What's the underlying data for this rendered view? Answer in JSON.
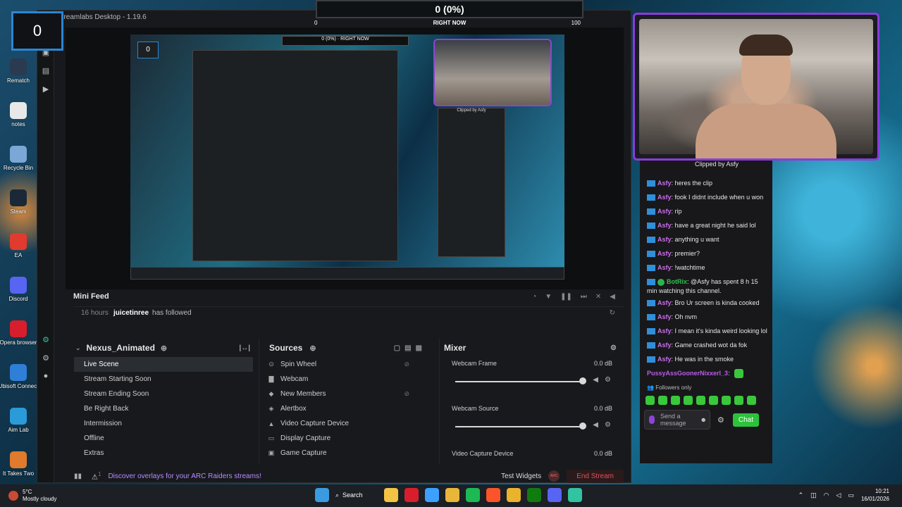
{
  "desktop": {
    "icons": [
      {
        "label": "Rematch",
        "color": "#2a3a50"
      },
      {
        "label": "notes",
        "color": "#e8e8e8"
      },
      {
        "label": "Recycle Bin",
        "color": "#7aa7d6"
      },
      {
        "label": "Steam",
        "color": "#1b2838"
      },
      {
        "label": "EA",
        "color": "#e03b2e"
      },
      {
        "label": "Discord",
        "color": "#5865f2"
      },
      {
        "label": "Opera browser",
        "color": "#d81e2c"
      },
      {
        "label": "Ubisoft Connect",
        "color": "#2f7fd8"
      },
      {
        "label": "Aim Lab",
        "color": "#2a9ad8"
      },
      {
        "label": "It Takes Two",
        "color": "#e07a2c"
      }
    ]
  },
  "counter": {
    "value": "0"
  },
  "goal": {
    "value": "0 (0%)",
    "label": "RIGHT NOW",
    "min": "0",
    "max": "100"
  },
  "app": {
    "title": "Streamlabs Desktop - 1.19.6",
    "preview": {
      "nested_counter": "0",
      "nested_goal_value": "0 (0%)",
      "nested_goal_label": "RIGHT NOW",
      "nested_clip_label": "Clipped by Asfy"
    },
    "minifeed": {
      "title": "Mini Feed",
      "items": [
        {
          "ago": "16 hours",
          "user": "juicetinree",
          "action": "has followed"
        }
      ]
    },
    "scenes": {
      "title": "Nexus_Animated",
      "items": [
        "Live Scene",
        "Stream Starting Soon",
        "Stream Ending Soon",
        "Be Right Back",
        "Intermission",
        "Offline",
        "Extras"
      ],
      "active": "Live Scene"
    },
    "sources": {
      "title": "Sources",
      "items": [
        "Spin Wheel",
        "Webcam",
        "New Members",
        "Alertbox",
        "Video Capture Device",
        "Display Capture",
        "Game Capture"
      ]
    },
    "mixer": {
      "title": "Mixer",
      "items": [
        {
          "name": "Webcam Frame",
          "db": "0.0 dB",
          "level": 1.0
        },
        {
          "name": "Webcam Source",
          "db": "0.0 dB",
          "level": 1.0
        },
        {
          "name": "Video Capture Device",
          "db": "0.0 dB",
          "level": 1.0
        }
      ]
    },
    "status": {
      "alert_count": "1",
      "promo": "Discover overlays for your ARC Raiders streams!",
      "test_widgets": "Test Widgets",
      "avatar_text": "ARC",
      "end_stream": "End Stream"
    }
  },
  "chat": {
    "clip_header": "Clipped by Asfy",
    "messages": [
      {
        "user": "Asfy",
        "text": ": heres the clip",
        "style": "purple"
      },
      {
        "user": "Asfy",
        "text": ": fook I didnt include when u won",
        "style": "purple"
      },
      {
        "user": "Asfy",
        "text": ": rip",
        "style": "purple"
      },
      {
        "user": "Asfy",
        "text": ": have a great night he said lol",
        "style": "purple"
      },
      {
        "user": "Asfy",
        "text": ": anything u want",
        "style": "purple"
      },
      {
        "user": "Asfy",
        "text": ": premier?",
        "style": "purple"
      },
      {
        "user": "Asfy",
        "text": ": !watchtime",
        "style": "purple"
      },
      {
        "user": "BotRix",
        "text": ": @Asfy has spent 8 h 15 min watching this channel.",
        "style": "green"
      },
      {
        "user": "Asfy",
        "text": ": Bro Ur screen is kinda cooked",
        "style": "purple"
      },
      {
        "user": "Asfy",
        "text": ": Oh nvm",
        "style": "purple"
      },
      {
        "user": "Asfy",
        "text": ": I mean it's kinda weird looking lol",
        "style": "purple"
      },
      {
        "user": "Asfy",
        "text": ": Game crashed wot da fok",
        "style": "purple"
      },
      {
        "user": "Asfy",
        "text": ": He was in the smoke",
        "style": "purple"
      },
      {
        "user": "PussyAssGoonerNixxerl_3",
        "text": ":",
        "style": "pink"
      }
    ],
    "followers_only": "Followers only",
    "input_placeholder": "Send a message",
    "send_label": "Chat"
  },
  "taskbar": {
    "weather_temp": "5°C",
    "weather_desc": "Mostly cloudy",
    "search_label": "Search",
    "apps": [
      {
        "name": "start",
        "color": "#3a9be0"
      },
      {
        "name": "explorer",
        "color": "#f3c343"
      },
      {
        "name": "opera",
        "color": "#d81e2c"
      },
      {
        "name": "copilot",
        "color": "#3ba0ff"
      },
      {
        "name": "files",
        "color": "#e8b73a"
      },
      {
        "name": "spotify",
        "color": "#1db954"
      },
      {
        "name": "brave",
        "color": "#fb542b"
      },
      {
        "name": "chrome",
        "color": "#e9b32c"
      },
      {
        "name": "xbox",
        "color": "#107c10"
      },
      {
        "name": "discord",
        "color": "#5865f2"
      },
      {
        "name": "streamlabs",
        "color": "#31c3a2"
      }
    ],
    "time": "10:21",
    "date": "16/01/2026"
  }
}
